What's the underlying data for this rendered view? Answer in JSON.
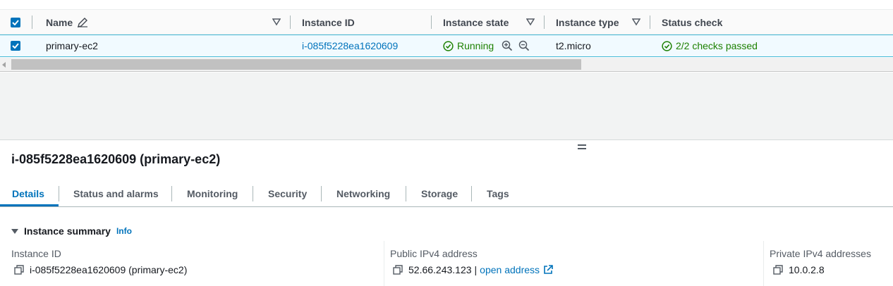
{
  "table": {
    "headers": {
      "name": "Name",
      "instance_id": "Instance ID",
      "instance_state": "Instance state",
      "instance_type": "Instance type",
      "status_check": "Status check"
    },
    "rows": [
      {
        "selected": true,
        "name": "primary-ec2",
        "instance_id": "i-085f5228ea1620609",
        "instance_state": "Running",
        "instance_type": "t2.micro",
        "status_check": "2/2 checks passed"
      }
    ]
  },
  "detail": {
    "title": "i-085f5228ea1620609 (primary-ec2)",
    "tabs": [
      "Details",
      "Status and alarms",
      "Monitoring",
      "Security",
      "Networking",
      "Storage",
      "Tags"
    ],
    "active_tab": "Details",
    "section": {
      "title": "Instance summary",
      "info_label": "Info"
    },
    "fields": {
      "instance_id_label": "Instance ID",
      "instance_id_value": "i-085f5228ea1620609 (primary-ec2)",
      "public_ip_label": "Public IPv4 address",
      "public_ip_value": "52.66.243.123",
      "public_ip_separator": "|",
      "open_address_label": "open address",
      "private_ip_label": "Private IPv4 addresses",
      "private_ip_value": "10.0.2.8"
    }
  },
  "colors": {
    "accent": "#0073bb",
    "success": "#1d8102",
    "selected_row_bg": "#f1faff",
    "selected_row_border": "#44b9d6"
  },
  "icons": [
    "checkbox-checked-icon",
    "edit-icon",
    "sort-icon",
    "status-ok-icon",
    "zoom-in-icon",
    "zoom-out-icon",
    "copy-icon",
    "external-link-icon",
    "caret-down-icon",
    "resize-handle-icon"
  ]
}
